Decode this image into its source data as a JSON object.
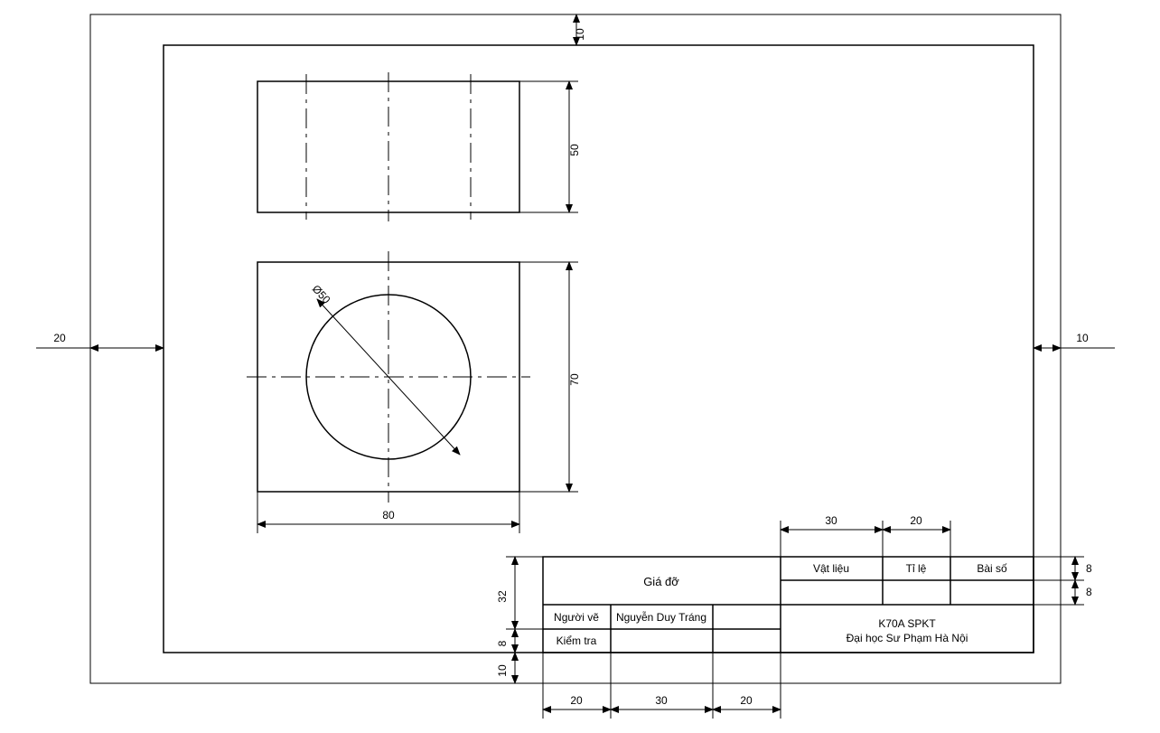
{
  "frame_dims": {
    "margin_top": "10",
    "margin_left": "20",
    "margin_right": "10"
  },
  "views": {
    "front": {
      "dim_h": "50"
    },
    "top": {
      "dim_h": "70",
      "dim_w": "80",
      "dia": "Ø50"
    }
  },
  "title_block": {
    "part_name": "Giá đỡ",
    "row_drawn_label": "Người vẽ",
    "row_drawn_value": "Nguyễn Duy Tráng",
    "row_check_label": "Kiểm tra",
    "hdr_material": "Vật liệu",
    "hdr_scale": "Tỉ lệ",
    "hdr_exercise": "Bài số",
    "institution_1": "K70A SPKT",
    "institution_2": "Đại học Sư Phạm Hà Nội",
    "dims": {
      "col0": "20",
      "col1": "30",
      "col2": "20",
      "row_h1": "32",
      "row_h2": "8",
      "row_gap": "10",
      "rcol0": "30",
      "rcol1": "20",
      "rrow": "8"
    }
  }
}
